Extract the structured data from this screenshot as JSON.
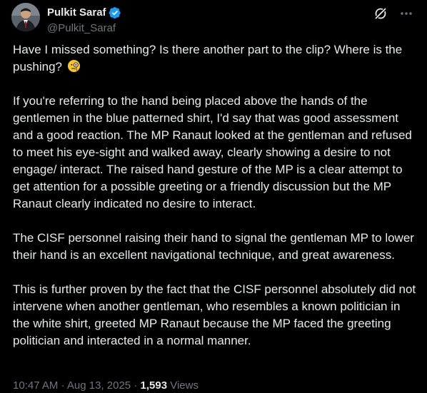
{
  "author": {
    "display_name": "Pulkit Saraf",
    "handle": "@Pulkit_Saraf",
    "verified_icon": "verified-badge-icon",
    "avatar": "avatar"
  },
  "header_actions": {
    "grok_icon": "grok-icon",
    "more_icon": "more-icon"
  },
  "post": {
    "paragraphs": [
      "Have I missed something? Is there another part to the clip? Where is the pushing?",
      "If you're referring to the hand being placed above the hands of the gentlemen in the blue patterned shirt, I'd say that was good assessment and a good reaction. The MP Ranaut looked at the gentleman and refused to meet his eye-sight and walked away, clearly showing a desire to not engage/ interact. The raised hand gesture of the MP is a clear attempt to get attention for a possible greeting or a friendly discussion but the MP Ranaut clearly indicated no desire to interact.",
      "The CISF personnel raising their hand to signal the gentleman MP to lower their hand is an excellent navigational technique, and great awareness.",
      "This is further proven by the fact that the CISF personnel absolutely did not intervene when another gentleman, who resembles a known politician in the white shirt, greeted MP Ranaut because the MP faced the greeting politician and interacted in a normal manner."
    ],
    "emoji_icon": "monocle-face-emoji-icon"
  },
  "meta": {
    "time": "10:47 AM",
    "separator": "·",
    "date": "Aug 13, 2025",
    "views_count": "1,593",
    "views_label": "Views"
  },
  "colors": {
    "background": "#000000",
    "text": "#e7e9ea",
    "secondary": "#71767b",
    "verified": "#1d9bf0"
  }
}
